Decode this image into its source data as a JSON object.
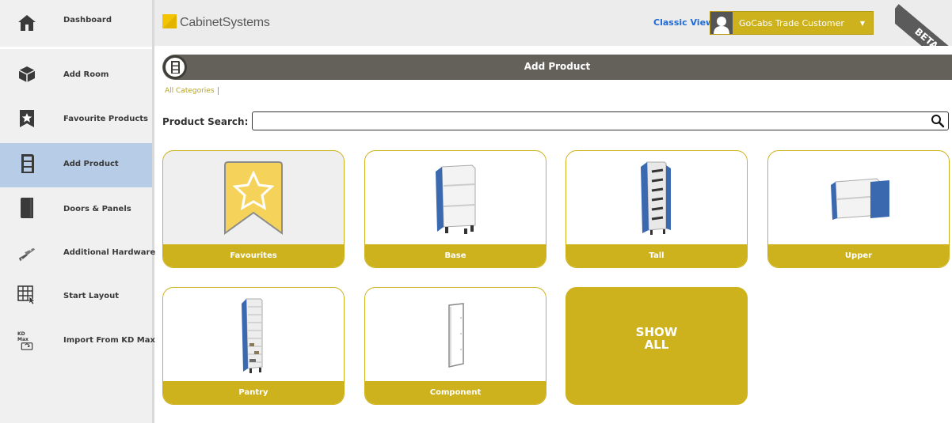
{
  "sidebar": {
    "items": [
      {
        "label": "Dashboard",
        "icon": "house-icon"
      },
      {
        "label": "Add Room",
        "icon": "room-box-icon"
      },
      {
        "label": "Favourite Products",
        "icon": "star-bookmark-icon"
      },
      {
        "label": "Add Product",
        "icon": "cabinet-icon"
      },
      {
        "label": "Doors & Panels",
        "icon": "door-panel-icon"
      },
      {
        "label": "Additional Hardware",
        "icon": "hardware-icon"
      },
      {
        "label": "Start Layout",
        "icon": "grid-layout-icon"
      },
      {
        "label": "Import From KD Max",
        "icon": "kdmax-import-icon"
      }
    ],
    "kdmax_icon_text": "KD Max"
  },
  "header": {
    "logo_text": "CabinetSystems",
    "classic_view": "Classic View",
    "user_name": "GoCabs Trade Customer",
    "beta": "BETA"
  },
  "page": {
    "title": "Add Product",
    "breadcrumb": "All Categories",
    "search_label": "Product Search:",
    "search_value": "",
    "search_placeholder": ""
  },
  "categories": [
    {
      "label": "Favourites"
    },
    {
      "label": "Base"
    },
    {
      "label": "Tall"
    },
    {
      "label": "Upper"
    },
    {
      "label": "Pantry"
    },
    {
      "label": "Component"
    }
  ],
  "show_all_line1": "SHOW",
  "show_all_line2": "ALL",
  "colors": {
    "accent_gold": "#cdb21d",
    "sidebar_active": "#b7cce6",
    "titlebar": "#64615b",
    "link_blue": "#1e6ad6",
    "cabinet_blue": "#3a69b0"
  }
}
